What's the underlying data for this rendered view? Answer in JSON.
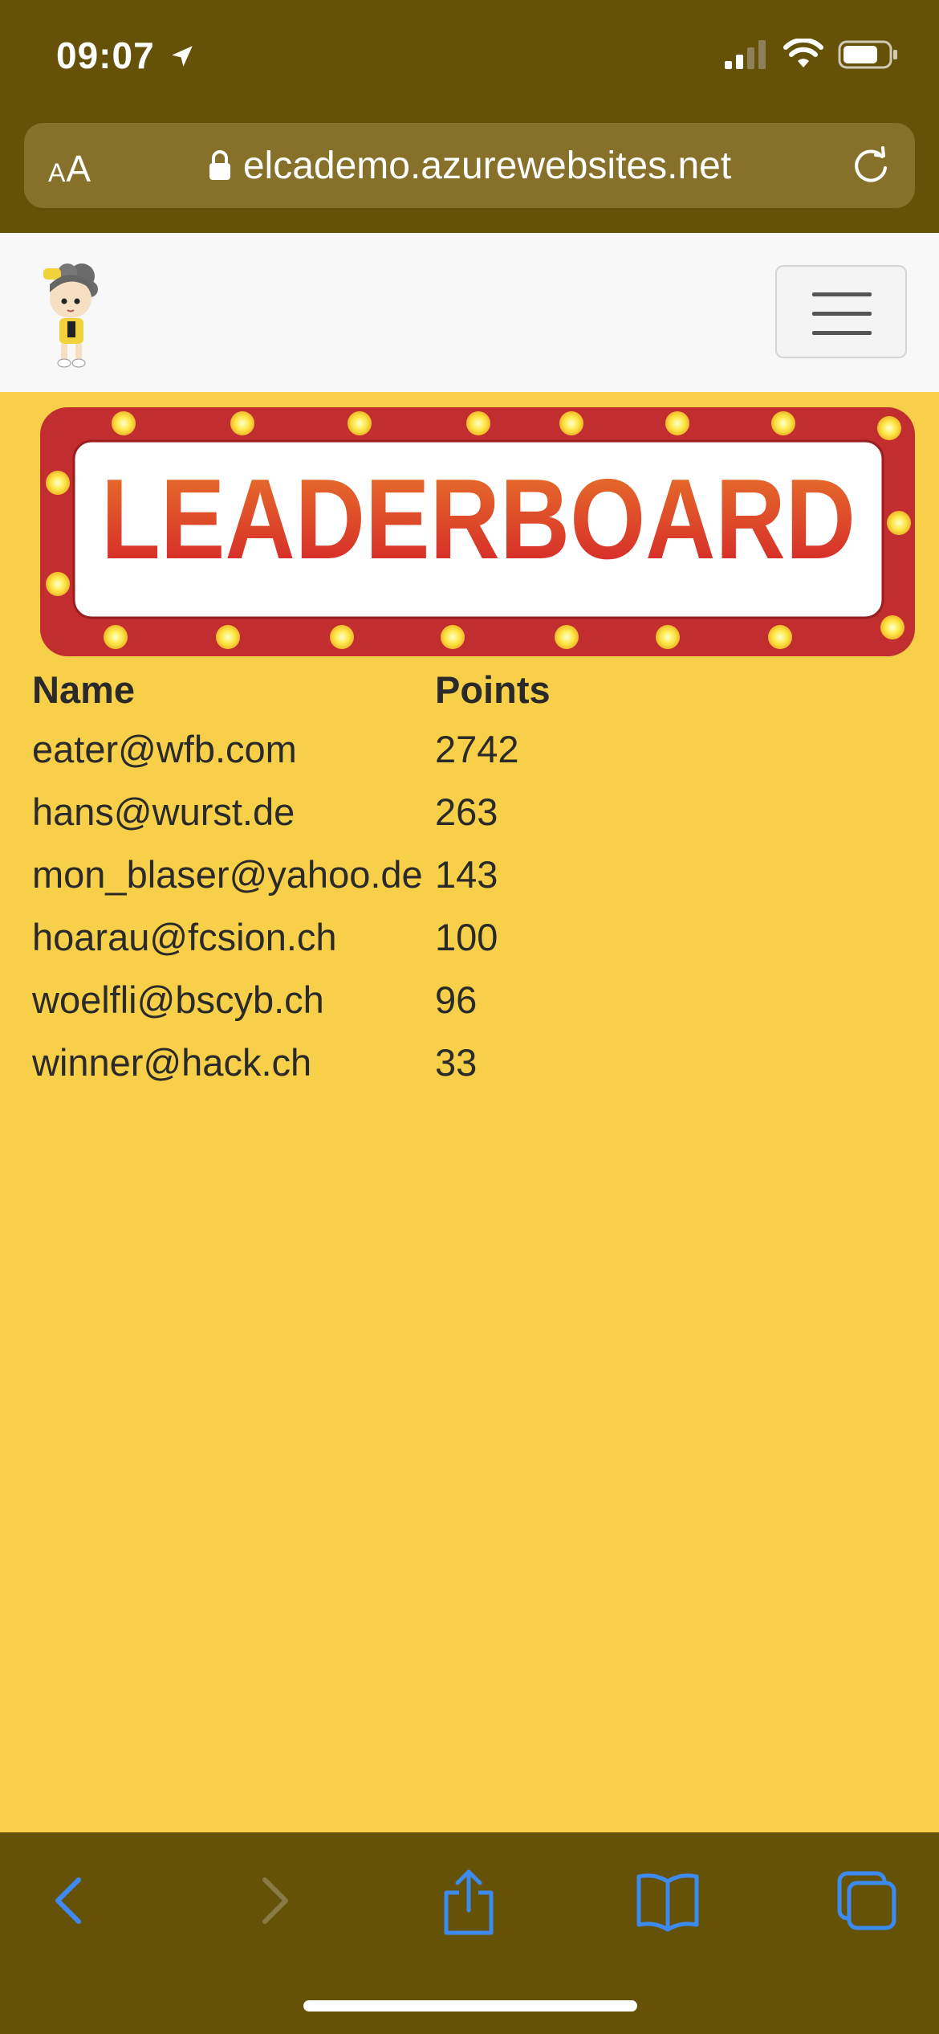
{
  "status_bar": {
    "time": "09:07"
  },
  "browser": {
    "text_size_label_small": "A",
    "text_size_label_large": "A",
    "url": "elcademo.azurewebsites.net"
  },
  "leaderboard": {
    "banner_text": "LEADERBOARD",
    "columns": [
      "Name",
      "Points"
    ],
    "rows": [
      {
        "name": "eater@wfb.com",
        "points": "2742"
      },
      {
        "name": "hans@wurst.de",
        "points": "263"
      },
      {
        "name": "mon_blaser@yahoo.de",
        "points": "143"
      },
      {
        "name": "hoarau@fcsion.ch",
        "points": "100"
      },
      {
        "name": "woelfli@bscyb.ch",
        "points": "96"
      },
      {
        "name": "winner@hack.ch",
        "points": "33"
      }
    ]
  },
  "toolbar": {
    "icons": [
      "back-icon",
      "forward-icon",
      "share-icon",
      "bookmarks-icon",
      "tabs-icon"
    ]
  },
  "colors": {
    "chrome": "#655208",
    "page_background": "#f7cf48",
    "accent_icons": "#3d8bf0"
  }
}
